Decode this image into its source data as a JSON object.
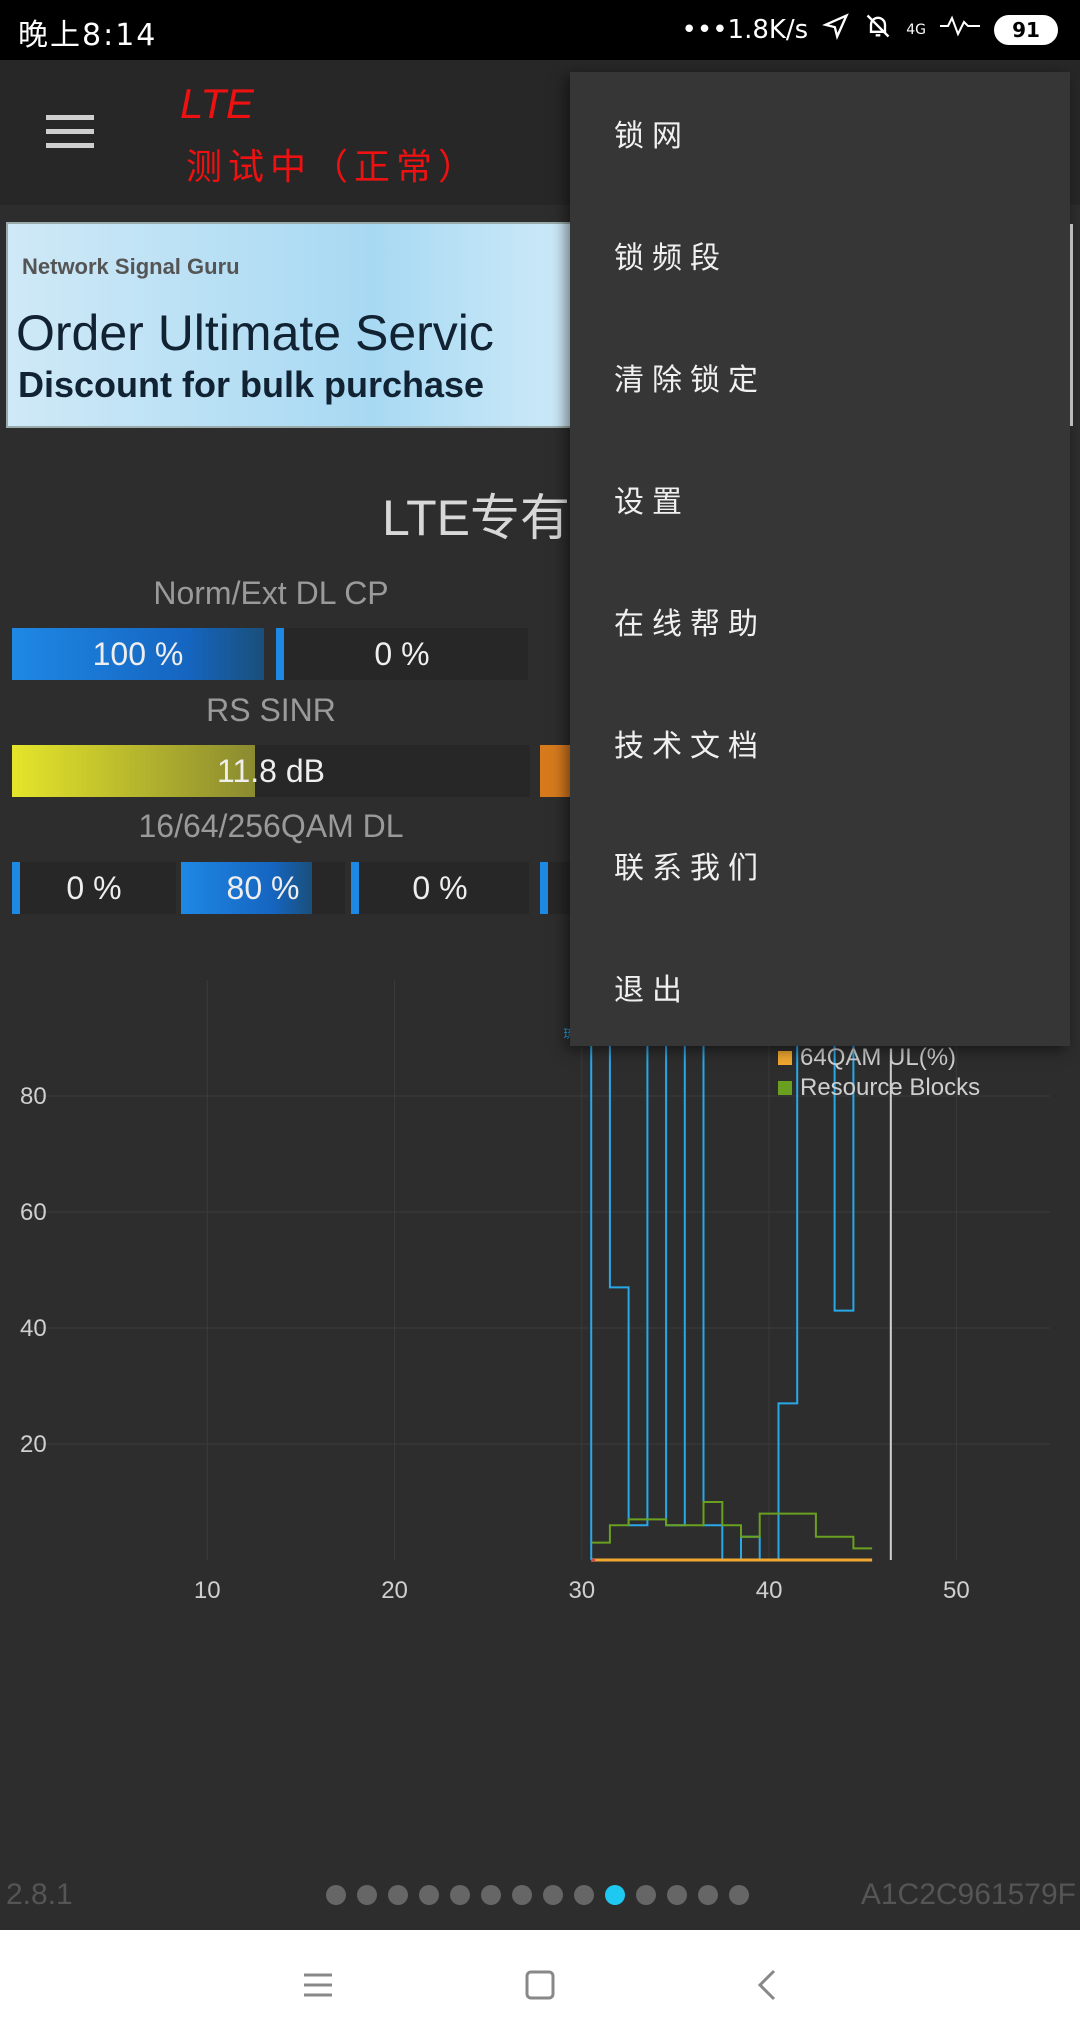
{
  "status_bar": {
    "time": "晚上8:14",
    "net_speed": "•••1.8K/s",
    "network_mini": "4G",
    "battery": "91"
  },
  "app_bar": {
    "title": "LTE",
    "subtitle": "测试中（正常）"
  },
  "banner": {
    "brand": "Network Signal Guru",
    "headline": "Order Ultimate Servic",
    "tagline": "Discount for bulk purchase"
  },
  "section_title": "LTE专有",
  "metrics": [
    {
      "label": "Norm/Ext DL CP",
      "bars": [
        {
          "text": "100 %",
          "fill": 1.0,
          "color": "blue"
        },
        {
          "text": "0 %",
          "fill": 0.0,
          "color": "blue"
        }
      ]
    },
    {
      "label": "RS SINR",
      "bars": [
        {
          "text": "11.8 dB",
          "fill": 0.47,
          "color": "yellow"
        }
      ]
    },
    {
      "label": "16/64/256QAM DL",
      "bars": [
        {
          "text": "0 %",
          "fill": 0.0,
          "color": "blue"
        },
        {
          "text": "80 %",
          "fill": 0.8,
          "color": "blue"
        },
        {
          "text": "0 %",
          "fill": 0.0,
          "color": "blue"
        }
      ]
    }
  ],
  "chart_data": {
    "type": "line",
    "x_ticks": [
      "10",
      "20",
      "30",
      "40",
      "50"
    ],
    "y_ticks": [
      "20",
      "40",
      "60",
      "80"
    ],
    "xlim": [
      0,
      55
    ],
    "ylim": [
      0,
      100
    ],
    "annotation": "琉璃社区",
    "legend": [
      "64QAM UL(%)",
      "Resource Blocks"
    ],
    "legend_colors": {
      "64QAM UL(%)": "#f0a830",
      "Resource Blocks": "#6aa020"
    },
    "series": [
      {
        "name": "",
        "color": "#29a8e8",
        "x": [
          30.5,
          30.5,
          31.5,
          31.5,
          32.5,
          32.5,
          33.5,
          33.5,
          34.5,
          34.5,
          35.5,
          35.5,
          36.5,
          36.5,
          37.5,
          37.5,
          38.5,
          38.5,
          39.5,
          39.5,
          40.5,
          40.5,
          41.5,
          41.5,
          42.5,
          42.5,
          43.5,
          43.5,
          44.5,
          44.5,
          45.5
        ],
        "y": [
          0,
          100,
          100,
          47,
          47,
          6,
          6,
          100,
          100,
          6,
          6,
          100,
          100,
          6,
          6,
          0,
          0,
          4,
          4,
          0,
          0,
          27,
          27,
          100,
          100,
          100,
          100,
          43,
          43,
          100,
          100
        ]
      },
      {
        "name": "64QAM UL(%)",
        "color": "#f0a830",
        "x": [
          30.5,
          45.5
        ],
        "y": [
          0,
          0
        ]
      },
      {
        "name": "Resource Blocks",
        "color": "#6aa020",
        "x": [
          30.5,
          31.5,
          31.5,
          32.5,
          32.5,
          34.5,
          34.5,
          36.5,
          36.5,
          37.5,
          37.5,
          38.5,
          38.5,
          39.5,
          39.5,
          42.5,
          42.5,
          44.5,
          44.5,
          45.5
        ],
        "y": [
          3,
          3,
          6,
          6,
          7,
          7,
          6,
          6,
          10,
          10,
          6,
          6,
          4,
          4,
          8,
          8,
          4,
          4,
          2,
          2
        ]
      }
    ]
  },
  "footer": {
    "version": "2.8.1",
    "device_id": "A1C2C961579F",
    "page_count": 14,
    "active_page": 9
  },
  "menu": {
    "items": [
      "锁网",
      "锁频段",
      "清除锁定",
      "设置",
      "在线帮助",
      "技术文档",
      "联系我们",
      "退出"
    ]
  }
}
